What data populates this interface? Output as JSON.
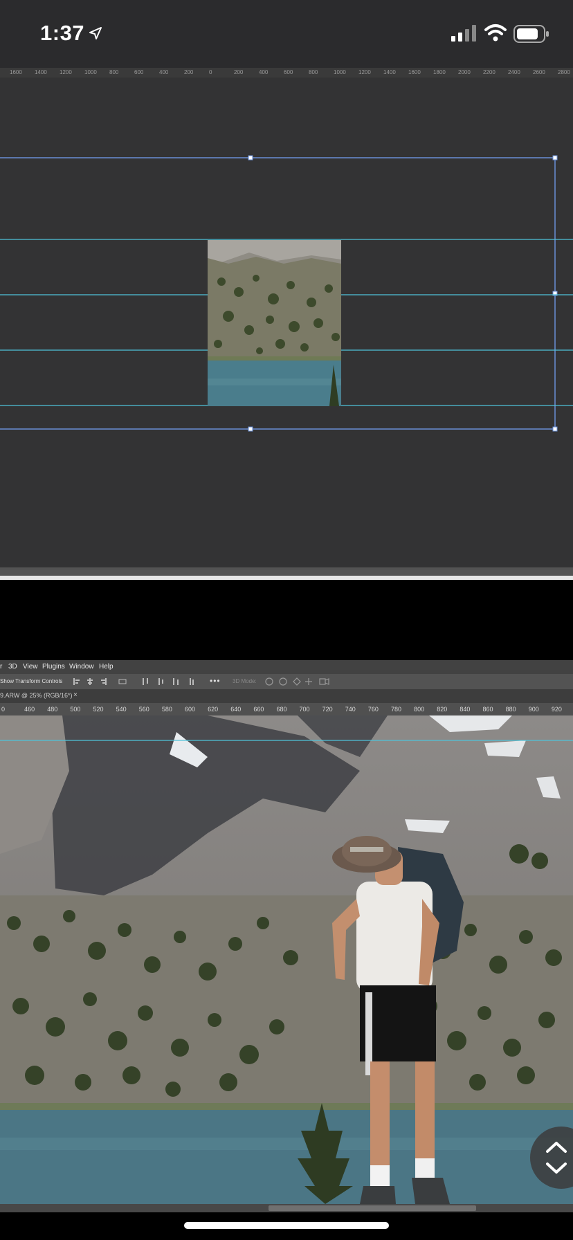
{
  "status_bar": {
    "time": "1:37",
    "icons": [
      "location-arrow-icon",
      "cellular-signal-icon",
      "wifi-icon",
      "battery-icon"
    ]
  },
  "top_ruler": {
    "ticks": [
      "1600",
      "1400",
      "1200",
      "1000",
      "800",
      "600",
      "400",
      "200",
      "0",
      "200",
      "400",
      "600",
      "800",
      "1000",
      "1200",
      "1400",
      "1600",
      "1800",
      "2000",
      "2200",
      "2400",
      "2600",
      "2800"
    ]
  },
  "photoshop": {
    "menu": [
      "3D",
      "View",
      "Plugins",
      "Window",
      "Help"
    ],
    "options_label": "Show Transform Controls",
    "mode_label": "3D Mode:",
    "doc_tab": "9.ARW @ 25% (RGB/16*)",
    "ruler_ticks": [
      "0",
      "460",
      "480",
      "500",
      "520",
      "540",
      "560",
      "580",
      "600",
      "620",
      "640",
      "660",
      "680",
      "700",
      "720",
      "740",
      "760",
      "780",
      "800",
      "820",
      "840",
      "860",
      "880",
      "900",
      "920"
    ]
  },
  "colors": {
    "guide": "#4fc3d9",
    "selection": "#6a8fd6",
    "canvas_bg": "#333334",
    "status_bg": "#2b2b2d"
  }
}
